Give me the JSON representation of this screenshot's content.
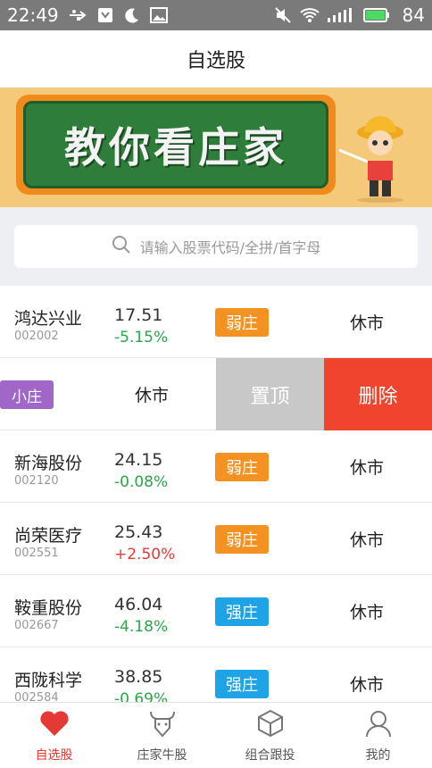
{
  "status_bar": {
    "time": "22:49",
    "battery": "84",
    "icons": [
      "usb-icon",
      "notification-icon",
      "moon-icon",
      "image-icon",
      "mute-icon",
      "wifi-icon",
      "signal-icon",
      "battery-icon"
    ]
  },
  "header": {
    "title": "自选股"
  },
  "banner": {
    "text": "教你看庄家"
  },
  "search": {
    "placeholder": "请输入股票代码/全拼/首字母"
  },
  "colors": {
    "weak": "#f39221",
    "strong": "#1ea4e6",
    "small": "#a066c8",
    "up": "#e53935",
    "down": "#2aa745",
    "delete": "#f0442c",
    "pin": "#c8c8c8",
    "active_tab": "#e53935"
  },
  "stocks": [
    {
      "name": "鸿达兴业",
      "code": "002002",
      "price": "17.51",
      "change": "-5.15%",
      "badge": "弱庄",
      "status": "休市"
    },
    {
      "badge": "小庄",
      "status": "休市",
      "actions": {
        "pin": "置顶",
        "delete": "删除"
      }
    },
    {
      "name": "新海股份",
      "code": "002120",
      "price": "24.15",
      "change": "-0.08%",
      "badge": "弱庄",
      "status": "休市"
    },
    {
      "name": "尚荣医疗",
      "code": "002551",
      "price": "25.43",
      "change": "+2.50%",
      "badge": "弱庄",
      "status": "休市"
    },
    {
      "name": "鞍重股份",
      "code": "002667",
      "price": "46.04",
      "change": "-4.18%",
      "badge": "强庄",
      "status": "休市"
    },
    {
      "name": "西陇科学",
      "code": "002584",
      "price": "38.85",
      "change": "-0.69%",
      "badge": "强庄",
      "status": "休市"
    }
  ],
  "tabs": [
    {
      "label": "自选股",
      "icon": "heart-icon",
      "active": true
    },
    {
      "label": "庄家牛股",
      "icon": "bull-icon",
      "active": false
    },
    {
      "label": "组合跟投",
      "icon": "cube-icon",
      "active": false
    },
    {
      "label": "我的",
      "icon": "user-icon",
      "active": false
    }
  ]
}
